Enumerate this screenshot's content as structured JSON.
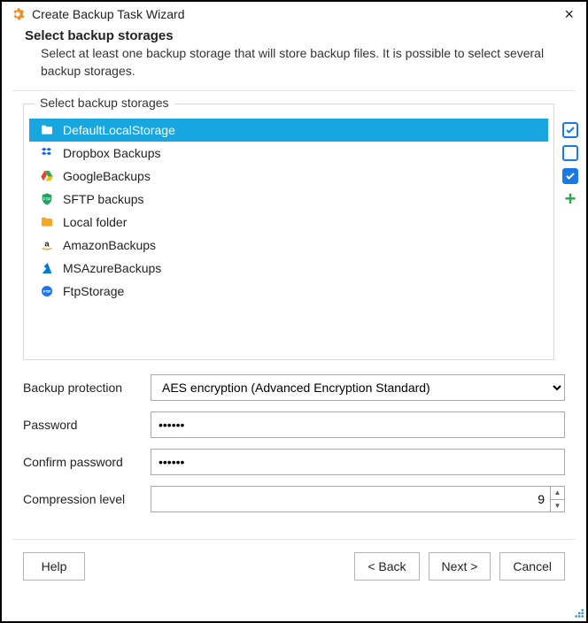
{
  "window": {
    "title": "Create Backup Task Wizard"
  },
  "header": {
    "heading": "Select backup storages",
    "description": "Select at least one backup storage that will store backup files. It is possible to select several backup storages."
  },
  "fieldset": {
    "legend": "Select backup storages"
  },
  "storages": [
    {
      "label": "DefaultLocalStorage",
      "icon": "folder-yellow",
      "selected": true
    },
    {
      "label": "Dropbox Backups",
      "icon": "dropbox",
      "selected": false
    },
    {
      "label": "GoogleBackups",
      "icon": "google-drive",
      "selected": false
    },
    {
      "label": "SFTP backups",
      "icon": "sftp-shield",
      "selected": false
    },
    {
      "label": "Local folder",
      "icon": "folder-yellow",
      "selected": false
    },
    {
      "label": "AmazonBackups",
      "icon": "amazon",
      "selected": false
    },
    {
      "label": "MSAzureBackups",
      "icon": "azure",
      "selected": false
    },
    {
      "label": "FtpStorage",
      "icon": "ftp",
      "selected": false
    }
  ],
  "sideButtons": {
    "check": {
      "checked": true,
      "filled": false
    },
    "uncheck": {
      "checked": false,
      "filled": false
    },
    "toggle": {
      "checked": true,
      "filled": true
    }
  },
  "form": {
    "backup_protection_label": "Backup protection",
    "backup_protection_value": "AES encryption (Advanced Encryption Standard)",
    "password_label": "Password",
    "password_value": "••••••",
    "confirm_password_label": "Confirm password",
    "confirm_password_value": "••••••",
    "compression_label": "Compression level",
    "compression_value": "9"
  },
  "footer": {
    "help": "Help",
    "back": "< Back",
    "next": "Next >",
    "cancel": "Cancel"
  }
}
